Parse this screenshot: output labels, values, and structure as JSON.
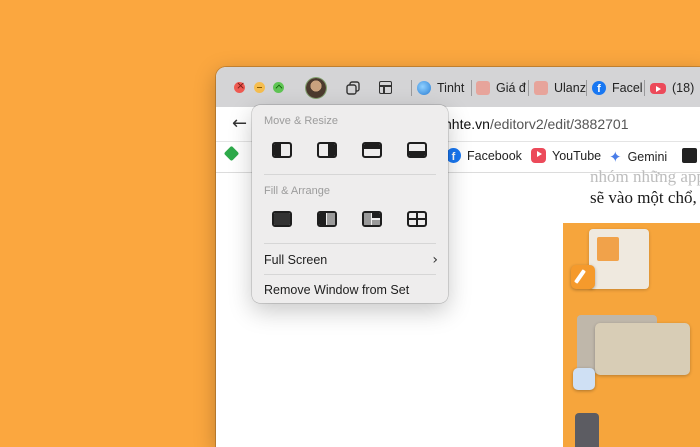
{
  "tabbar": {
    "tabs": [
      {
        "label": "Tinht",
        "icon": "globe-icon"
      },
      {
        "label": "Giá đ",
        "icon": "shopping-bag-icon"
      },
      {
        "label": "Ulanz",
        "icon": "shopping-bag-icon"
      },
      {
        "label": "Facel",
        "icon": "facebook-icon"
      },
      {
        "label": "(18)",
        "icon": "youtube-icon"
      }
    ]
  },
  "address": {
    "host": "nhte.vn",
    "path": "/editorv2/edit/3882701"
  },
  "bookmarks": [
    {
      "label": "Facebook",
      "icon": "facebook-icon"
    },
    {
      "label": "YouTube",
      "icon": "youtube-icon"
    },
    {
      "label": "Gemini",
      "icon": "gemini-icon"
    }
  ],
  "page": {
    "faded_line": "nhóm những app c",
    "body_line": "sẽ vào một chổ, ch"
  },
  "menu": {
    "move_resize_header": "Move & Resize",
    "fill_arrange_header": "Fill & Arrange",
    "full_screen": "Full Screen",
    "remove_window": "Remove Window from Set",
    "move_resize_options": [
      "left-half",
      "right-half",
      "top-half",
      "bottom-half"
    ],
    "fill_arrange_options": [
      "fill",
      "left-right",
      "left-quarters",
      "quarters"
    ]
  },
  "colors": {
    "desktop": "#fba73f",
    "close": "#ee5a52",
    "minimize": "#f5bd4f",
    "zoom": "#5fc454"
  }
}
